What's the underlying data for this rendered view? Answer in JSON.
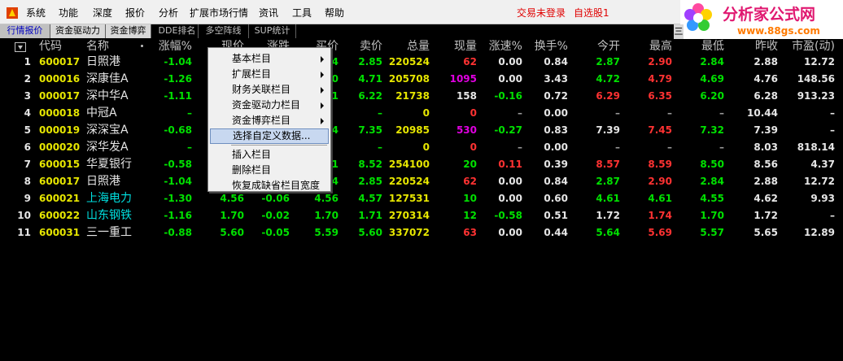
{
  "menubar": {
    "items": [
      "系统",
      "功能",
      "深度",
      "报价",
      "分析",
      "扩展市场行情",
      "资讯",
      "工具",
      "帮助"
    ],
    "status_login": "交易未登录",
    "status_watchlist": "自选股1"
  },
  "logo": {
    "title": "分析家公式网",
    "url": "www.88gs.com"
  },
  "tabs": [
    {
      "label": "行情报价",
      "state": "active"
    },
    {
      "label": "资金驱动力",
      "state": "light"
    },
    {
      "label": "资金博弈",
      "state": "light"
    },
    {
      "label": "DDE排名",
      "state": "dark"
    },
    {
      "label": "多空阵线",
      "state": "dark"
    },
    {
      "label": "SUP统计",
      "state": "dark"
    }
  ],
  "tab_ghost_right": "三",
  "columns": [
    "",
    "代码",
    "名称",
    "涨幅%",
    "现价",
    "涨跌",
    "买价",
    "卖价",
    "总量",
    "现量",
    "涨速%",
    "换手%",
    "今开",
    "最高",
    "最低",
    "昨收",
    "市盈(动)"
  ],
  "rows": [
    {
      "idx": "1",
      "code": "600017",
      "name": "日照港",
      "name_color": "white",
      "chg_pct": "-1.04",
      "price": "",
      "change": "",
      "bid": "4",
      "ask": "2.85",
      "vol": "220524",
      "cur_vol": "62",
      "cur_vol_color": "red",
      "speed": "0.00",
      "speed_color": "white",
      "turnover": "0.84",
      "open": "2.87",
      "open_color": "green",
      "high": "2.90",
      "high_color": "red",
      "low": "2.84",
      "low_color": "green",
      "prev": "2.88",
      "pe": "12.72"
    },
    {
      "idx": "2",
      "code": "000016",
      "name": "深康佳A",
      "name_color": "white",
      "chg_pct": "-1.26",
      "price": "",
      "change": "",
      "bid": "0",
      "ask": "4.71",
      "vol": "205708",
      "cur_vol": "1095",
      "cur_vol_color": "magenta",
      "speed": "0.00",
      "speed_color": "white",
      "turnover": "3.43",
      "open": "4.72",
      "open_color": "green",
      "high": "4.79",
      "high_color": "red",
      "low": "4.69",
      "low_color": "green",
      "prev": "4.76",
      "pe": "148.56"
    },
    {
      "idx": "3",
      "code": "000017",
      "name": "深中华A",
      "name_color": "white",
      "chg_pct": "-1.11",
      "price": "",
      "change": "",
      "bid": "1",
      "ask": "6.22",
      "vol": "21738",
      "cur_vol": "158",
      "cur_vol_color": "white",
      "speed": "-0.16",
      "speed_color": "green",
      "turnover": "0.72",
      "open": "6.29",
      "open_color": "red",
      "high": "6.35",
      "high_color": "red",
      "low": "6.20",
      "low_color": "green",
      "prev": "6.28",
      "pe": "913.23"
    },
    {
      "idx": "4",
      "code": "000018",
      "name": "中冠A",
      "name_color": "white",
      "chg_pct": "–",
      "price": "",
      "change": "",
      "bid": "",
      "ask": "–",
      "vol": "0",
      "cur_vol": "0",
      "cur_vol_color": "red",
      "speed": "–",
      "speed_color": "gray",
      "turnover": "0.00",
      "open": "–",
      "open_color": "gray",
      "high": "–",
      "high_color": "gray",
      "low": "–",
      "low_color": "gray",
      "prev": "10.44",
      "pe": "–"
    },
    {
      "idx": "5",
      "code": "000019",
      "name": "深深宝A",
      "name_color": "white",
      "chg_pct": "-0.68",
      "price": "",
      "change": "",
      "bid": "4",
      "ask": "7.35",
      "vol": "20985",
      "cur_vol": "530",
      "cur_vol_color": "magenta",
      "speed": "-0.27",
      "speed_color": "green",
      "turnover": "0.83",
      "open": "7.39",
      "open_color": "white",
      "high": "7.45",
      "high_color": "red",
      "low": "7.32",
      "low_color": "green",
      "prev": "7.39",
      "pe": "–"
    },
    {
      "idx": "6",
      "code": "000020",
      "name": "深华发A",
      "name_color": "white",
      "chg_pct": "–",
      "price": "",
      "change": "",
      "bid": "",
      "ask": "–",
      "vol": "0",
      "cur_vol": "0",
      "cur_vol_color": "red",
      "speed": "–",
      "speed_color": "gray",
      "turnover": "0.00",
      "open": "–",
      "open_color": "gray",
      "high": "–",
      "high_color": "gray",
      "low": "–",
      "low_color": "gray",
      "prev": "8.03",
      "pe": "818.14"
    },
    {
      "idx": "7",
      "code": "600015",
      "name": "华夏银行",
      "name_color": "white",
      "chg_pct": "-0.58",
      "price": "",
      "change": "",
      "bid": "1",
      "ask": "8.52",
      "vol": "254100",
      "cur_vol": "20",
      "cur_vol_color": "green",
      "speed": "0.11",
      "speed_color": "red",
      "turnover": "0.39",
      "open": "8.57",
      "open_color": "red",
      "high": "8.59",
      "high_color": "red",
      "low": "8.50",
      "low_color": "green",
      "prev": "8.56",
      "pe": "4.37"
    },
    {
      "idx": "8",
      "code": "600017",
      "name": "日照港",
      "name_color": "white",
      "chg_pct": "-1.04",
      "price": "",
      "change": "",
      "bid": "4",
      "ask": "2.85",
      "vol": "220524",
      "cur_vol": "62",
      "cur_vol_color": "red",
      "speed": "0.00",
      "speed_color": "white",
      "turnover": "0.84",
      "open": "2.87",
      "open_color": "green",
      "high": "2.90",
      "high_color": "red",
      "low": "2.84",
      "low_color": "green",
      "prev": "2.88",
      "pe": "12.72"
    },
    {
      "idx": "9",
      "code": "600021",
      "name": "上海电力",
      "name_color": "cyan",
      "chg_pct": "-1.30",
      "price": "4.56",
      "change": "-0.06",
      "bid": "4.56",
      "ask": "4.57",
      "vol": "127531",
      "cur_vol": "10",
      "cur_vol_color": "green",
      "speed": "0.00",
      "speed_color": "white",
      "turnover": "0.60",
      "open": "4.61",
      "open_color": "green",
      "high": "4.61",
      "high_color": "green",
      "low": "4.55",
      "low_color": "green",
      "prev": "4.62",
      "pe": "9.93"
    },
    {
      "idx": "10",
      "code": "600022",
      "name": "山东钢铁",
      "name_color": "cyan",
      "chg_pct": "-1.16",
      "price": "1.70",
      "change": "-0.02",
      "bid": "1.70",
      "ask": "1.71",
      "vol": "270314",
      "cur_vol": "12",
      "cur_vol_color": "green",
      "speed": "-0.58",
      "speed_color": "green",
      "turnover": "0.51",
      "open": "1.72",
      "open_color": "white",
      "high": "1.74",
      "high_color": "red",
      "low": "1.70",
      "low_color": "green",
      "prev": "1.72",
      "pe": "–"
    },
    {
      "idx": "11",
      "code": "600031",
      "name": "三一重工",
      "name_color": "white",
      "chg_pct": "-0.88",
      "price": "5.60",
      "change": "-0.05",
      "bid": "5.59",
      "ask": "5.60",
      "vol": "337072",
      "cur_vol": "63",
      "cur_vol_color": "red",
      "speed": "0.00",
      "speed_color": "white",
      "turnover": "0.44",
      "open": "5.64",
      "open_color": "green",
      "high": "5.69",
      "high_color": "red",
      "low": "5.57",
      "low_color": "green",
      "prev": "5.65",
      "pe": "12.89"
    }
  ],
  "context_menu": {
    "items": [
      {
        "label": "基本栏目",
        "submenu": true
      },
      {
        "label": "扩展栏目",
        "submenu": true
      },
      {
        "label": "财务关联栏目",
        "submenu": true
      },
      {
        "label": "资金驱动力栏目",
        "submenu": true
      },
      {
        "label": "资金博弈栏目",
        "submenu": true
      },
      {
        "label": "选择自定义数据...",
        "submenu": false,
        "highlighted": true
      },
      {
        "label": "插入栏目",
        "submenu": false
      },
      {
        "label": "删除栏目",
        "submenu": false
      },
      {
        "label": "恢复成缺省栏目宽度",
        "submenu": false
      }
    ]
  },
  "colors": {
    "background": "#000000",
    "up": "#ff3232",
    "down": "#00e000",
    "code": "#e6e600",
    "name_highlight": "#00e0e0",
    "volume_spike": "#e000e0",
    "status_alert": "#e00000"
  }
}
